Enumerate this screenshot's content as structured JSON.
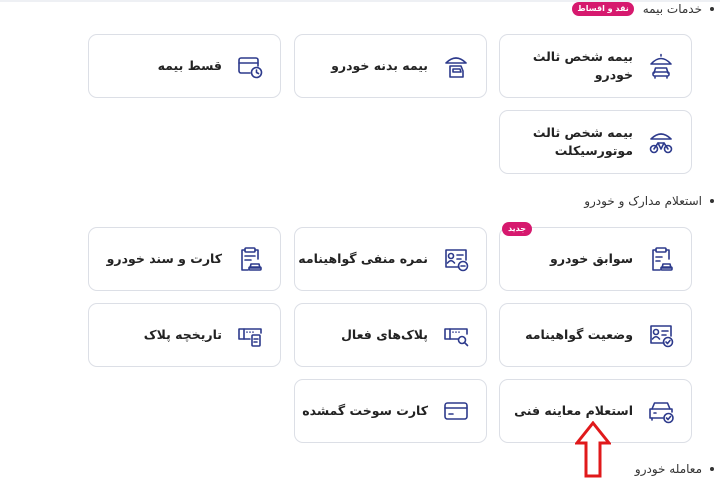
{
  "sections": {
    "insurance": {
      "title": "خدمات بیمه",
      "badge": "نقد و اقساط"
    },
    "documents": {
      "title": "استعلام مدارک و خودرو"
    },
    "trade": {
      "title": "معامله خودرو"
    }
  },
  "cards": {
    "third_party_car": {
      "label": "بیمه شخص ثالث خودرو",
      "icon": "umbrella-car-icon"
    },
    "car_body": {
      "label": "بیمه بدنه خودرو",
      "icon": "umbrella-car-body-icon"
    },
    "installment": {
      "label": "قسط بیمه",
      "icon": "card-clock-icon"
    },
    "third_party_moto": {
      "label": "بیمه شخص ثالث موتورسیکلت",
      "icon": "umbrella-motorcycle-icon"
    },
    "car_history": {
      "label": "سوابق خودرو",
      "icon": "clipboard-car-icon",
      "badge": "جدید"
    },
    "license_points": {
      "label": "نمره منفی گواهینامه",
      "icon": "license-minus-icon"
    },
    "car_docs": {
      "label": "کارت و سند خودرو",
      "icon": "clipboard-car-docs-icon"
    },
    "license_status": {
      "label": "وضعیت گواهینامه",
      "icon": "license-check-icon"
    },
    "active_plates": {
      "label": "پلاک‌های فعال",
      "icon": "plate-search-icon"
    },
    "plate_history": {
      "label": "تاریخچه پلاک",
      "icon": "plate-history-icon"
    },
    "inspection": {
      "label": "استعلام معاینه فنی",
      "icon": "car-check-icon"
    },
    "lost_fuel_card": {
      "label": "کارت سوخت گمشده",
      "icon": "fuel-card-icon"
    }
  },
  "colors": {
    "accent": "#2d3a8c",
    "badge": "#d6196e",
    "arrow": "#e0191b"
  }
}
